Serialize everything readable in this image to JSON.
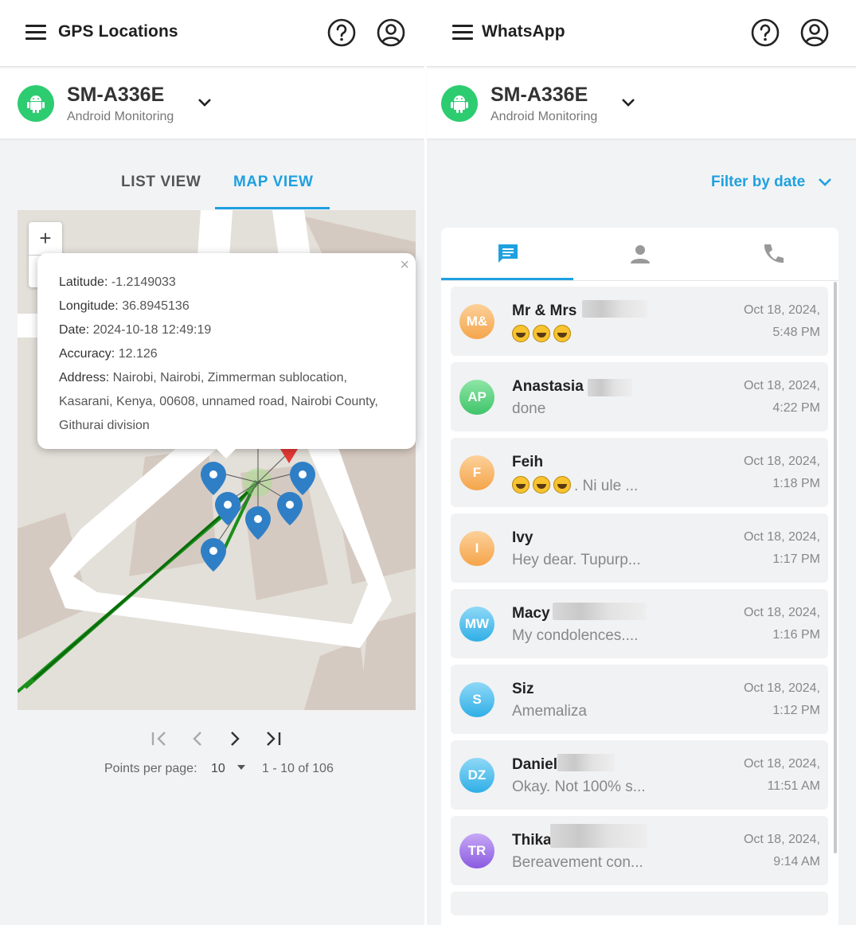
{
  "left": {
    "header": {
      "title": "GPS Locations",
      "help_icon": "help-circle-icon",
      "account_icon": "account-circle-icon"
    },
    "device": {
      "name": "SM-A336E",
      "subtitle": "Android Monitoring"
    },
    "tabs": [
      {
        "label": "LIST VIEW",
        "active": false
      },
      {
        "label": "MAP VIEW",
        "active": true
      }
    ],
    "popup": {
      "rows": [
        {
          "key": "Latitude:",
          "value": "-1.2149033"
        },
        {
          "key": "Longitude:",
          "value": "36.8945136"
        },
        {
          "key": "Date:",
          "value": "2024-10-18 12:49:19"
        },
        {
          "key": "Accuracy:",
          "value": "12.126"
        },
        {
          "key": "Address:",
          "value": "Nairobi, Nairobi, Zimmerman sublocation, Kasarani, Kenya, 00608, unnamed road, Nairobi County, Githurai division"
        }
      ],
      "close": "×"
    },
    "zoom": {
      "in": "+",
      "out": "−"
    },
    "pagination": {
      "points_label": "Points per page:",
      "per_page": "10",
      "range": "1 - 10 of 106"
    }
  },
  "right": {
    "header": {
      "title": "WhatsApp",
      "help_icon": "help-circle-icon",
      "account_icon": "account-circle-icon"
    },
    "device": {
      "name": "SM-A336E",
      "subtitle": "Android Monitoring"
    },
    "filter_label": "Filter by date",
    "category_tabs": [
      "chats-icon",
      "contacts-icon",
      "calls-icon"
    ],
    "chats": [
      {
        "initials": "M&",
        "name": "Mr & Mrs",
        "message": "",
        "emojis": 3,
        "date": "Oct 18, 2024,",
        "time": "5:48 PM",
        "color": "#f6b96a"
      },
      {
        "initials": "AP",
        "name": "Anastasia",
        "message": "done",
        "emojis": 0,
        "date": "Oct 18, 2024,",
        "time": "4:22 PM",
        "color": "#4fd07a"
      },
      {
        "initials": "F",
        "name": "Feih",
        "message": ". Ni ule ...",
        "emojis": 3,
        "date": "Oct 18, 2024,",
        "time": "1:18 PM",
        "color": "#f6b96a"
      },
      {
        "initials": "I",
        "name": "Ivy",
        "message": "Hey dear. Tupurp...",
        "emojis": 0,
        "date": "Oct 18, 2024,",
        "time": "1:17 PM",
        "color": "#f6b96a"
      },
      {
        "initials": "MW",
        "name": "Macy",
        "message": "My condolences....",
        "emojis": 0,
        "date": "Oct 18, 2024,",
        "time": "1:16 PM",
        "color": "#3fb8ec"
      },
      {
        "initials": "S",
        "name": "Siz",
        "message": "Amemaliza",
        "emojis": 0,
        "date": "Oct 18, 2024,",
        "time": "1:12 PM",
        "color": "#3fb8ec"
      },
      {
        "initials": "DZ",
        "name": "Daniel",
        "message": "Okay. Not 100% s...",
        "emojis": 0,
        "date": "Oct 18, 2024,",
        "time": "11:51 AM",
        "color": "#3fb8ec"
      },
      {
        "initials": "TR",
        "name": "Thika",
        "message": "Bereavement con...",
        "emojis": 0,
        "date": "Oct 18, 2024,",
        "time": "9:14 AM",
        "color": "#9b6fe8"
      }
    ]
  }
}
